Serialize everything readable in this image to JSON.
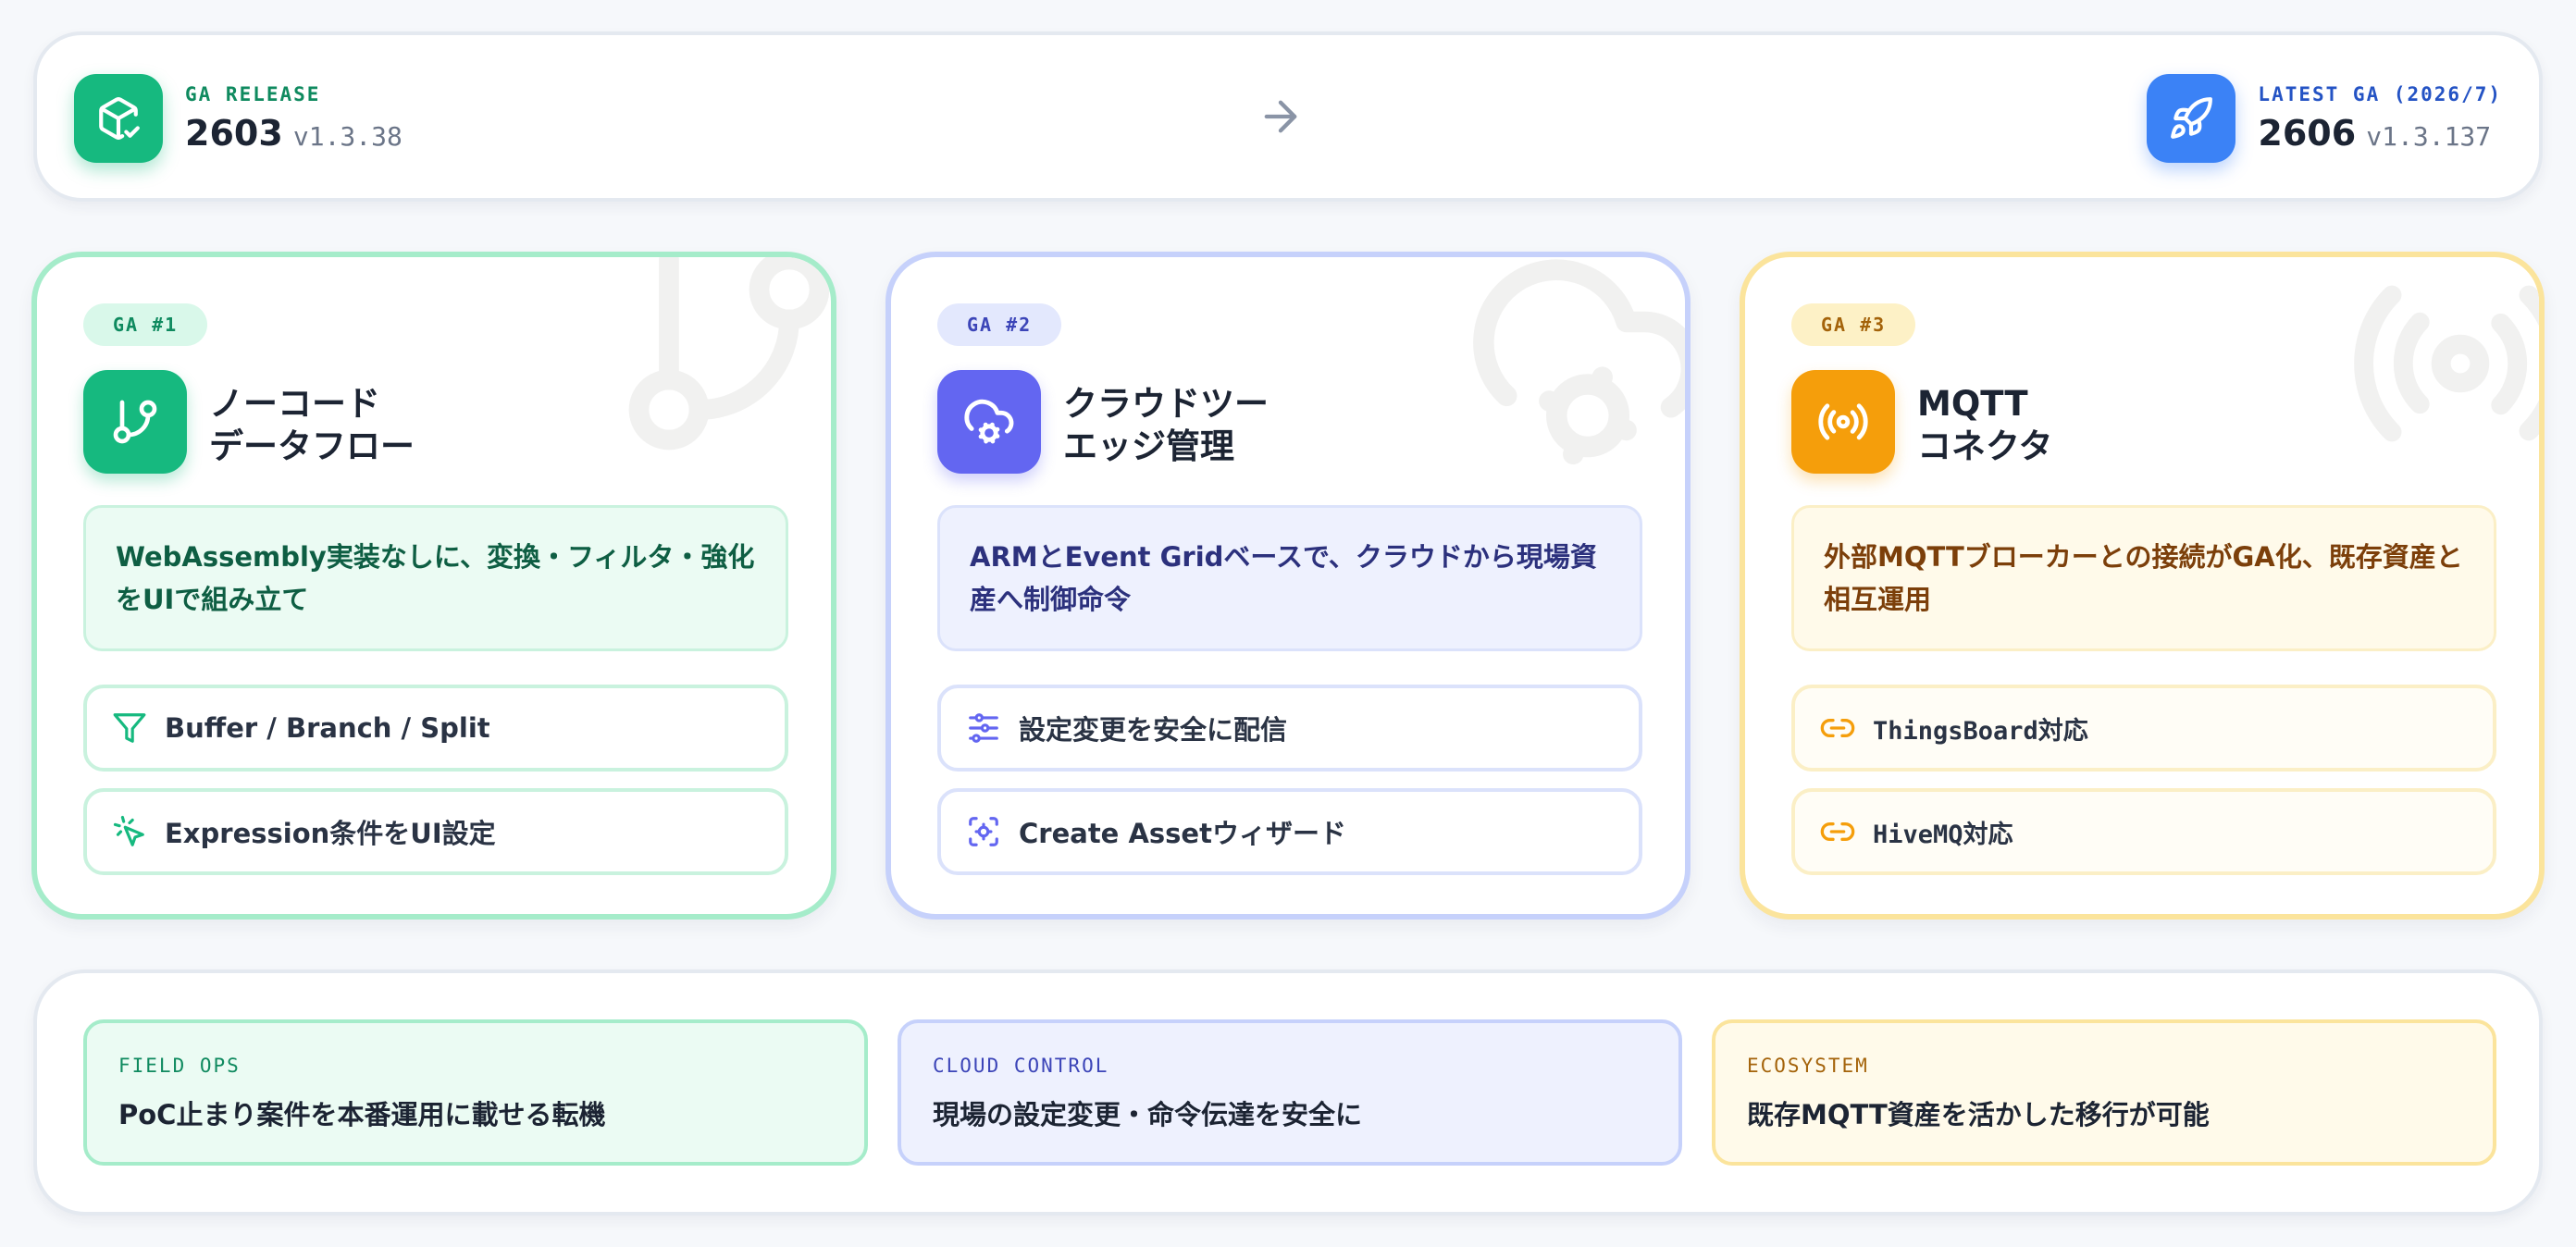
{
  "release": {
    "from": {
      "kicker": "GA RELEASE",
      "number": "2603",
      "version": "v1.3.38",
      "icon": "package-check-icon",
      "color": "#16b97f"
    },
    "to": {
      "kicker": "LATEST GA (2026/7)",
      "number": "2606",
      "version": "v1.3.137",
      "icon": "rocket-icon",
      "color": "#3b82f6"
    },
    "arrow_icon": "arrow-right-icon"
  },
  "cards": [
    {
      "badge": "GA #1",
      "title_line1": "ノーコード",
      "title_line2": "データフロー",
      "icon": "git-branch-icon",
      "accent": "#16b97f",
      "description": "WebAssembly実装なしに、変換・フィルタ・強化をUIで組み立て",
      "features": [
        {
          "label": "Buffer / Branch / Split",
          "icon": "filter-icon"
        },
        {
          "label": "Expression条件をUI設定",
          "icon": "cursor-click-icon"
        }
      ]
    },
    {
      "badge": "GA #2",
      "title_line1": "クラウドツー",
      "title_line2": "エッジ管理",
      "icon": "cloud-cog-icon",
      "accent": "#6366f1",
      "description": "ARMとEvent Gridベースで、クラウドから現場資産へ制御命令",
      "features": [
        {
          "label": "設定変更を安全に配信",
          "icon": "sliders-icon"
        },
        {
          "label": "Create Assetウィザード",
          "icon": "asset-scan-icon"
        }
      ]
    },
    {
      "badge": "GA #3",
      "title_line1": "MQTT",
      "title_line2": "コネクタ",
      "icon": "broadcast-icon",
      "accent": "#f59e0b",
      "description": "外部MQTTブローカーとの接続がGA化、既存資産と相互運用",
      "features": [
        {
          "label": "ThingsBoard対応",
          "icon": "link-icon"
        },
        {
          "label": "HiveMQ対応",
          "icon": "link-icon"
        }
      ]
    }
  ],
  "impacts": [
    {
      "kicker": "FIELD OPS",
      "text": "PoC止まり案件を本番運用に載せる転機"
    },
    {
      "kicker": "CLOUD CONTROL",
      "text": "現場の設定変更・命令伝達を安全に"
    },
    {
      "kicker": "ECOSYSTEM",
      "text": "既存MQTT資産を活かした移行が可能"
    }
  ]
}
